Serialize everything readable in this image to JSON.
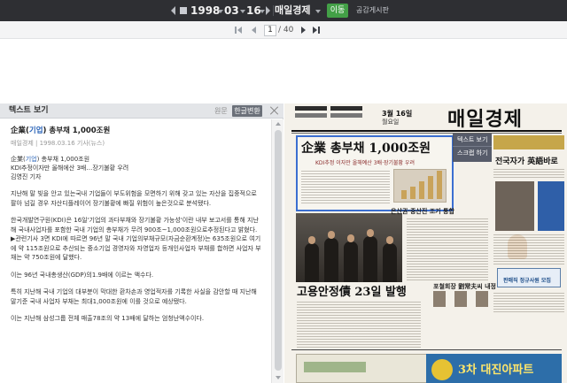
{
  "topbar": {
    "year": "1998",
    "month": "03",
    "day": "16",
    "paper_name": "매일경제",
    "go_label": "이동",
    "notice_label": "공감게시판"
  },
  "pager": {
    "current_page": "1",
    "total": "/ 40"
  },
  "panel": {
    "title": "텍스트 보기",
    "original_tab": "원문",
    "convert_button": "한글변환",
    "article": {
      "title_prefix": "企業(",
      "title_hl": "기업",
      "title_suffix": ") 총부채 1,000조원",
      "meta": "매일경제 | 1998.03.16 기사(뉴스)",
      "line1_prefix": "企業(",
      "line1_hl": "기업",
      "line1_suffix": ") 총부채 1,000조원",
      "line2": "KDI추정이자만 올해에산 3배…장기불황 우려",
      "line3": "김영진 기자",
      "para1": "지난해 말 빚을 안고 있는국내 기업들이 부도위험을 모면하기 위해 갖고 있는 자산을 집중적으로 팔아 넘길 경우 자산디플레이어 장기불황에 빠질 위험이 높은것으로 분석됐다.",
      "para2": "한국개발연구원(KDI)은 16일'기업의 과다부채와 장기불황 가능성'이란 내부 보고서를 통해 지난해 국내사업자를 포함한 국내 기업의 총부채가 무려 900조~1,000조원으로추정된다고 밝혔다. ▶관련기사 3면 KDI에 따르면 96년 말 국내 기업의부채규모(자금순환계정)는 635조원으로 여기에 약 115조원으로 추산되는 중소기업 경영자와 자영업자 등개인사업자 부채를 합하면 사업자 부채는 약 750조원에 달했다.",
      "para3": "이는 96년 국내총생산(GDP)의1.9배에 이르는 액수다.",
      "para4": "특히 지난해 국내 기업의 대부분이 막대한 환차손과 영업적자를 기록한 사실을 감안할 때 지난해 말기준 국내 사업자 부채는 최대1,000조원에 이를 것으로 예상됐다.",
      "para5": "이는 지난해 삼성그룹 전체 매출78조의 약 13배에 달하는 엄청난액수이다."
    }
  },
  "newspaper": {
    "masthead": "매일경제",
    "date_line": "3월 16일",
    "day_line": "월요일",
    "headline": "企業 총부채 1,000조원",
    "subhead": "KDI추정 이자만 올해예산 3배·장기불황 우려",
    "popup_text_view": "텍스트 보기",
    "popup_scrap": "스크랩 하기",
    "right_kicker": "전국자가 英語바로",
    "mid_head": "은산권·중산진 조기 통합",
    "big_head": "고용안정債 23일 발행",
    "mid_head2": "포철회장 劉常夫씨 내정",
    "box_title": "판매직 정규사원 모집",
    "ad_text": "3차 대진아파트"
  }
}
